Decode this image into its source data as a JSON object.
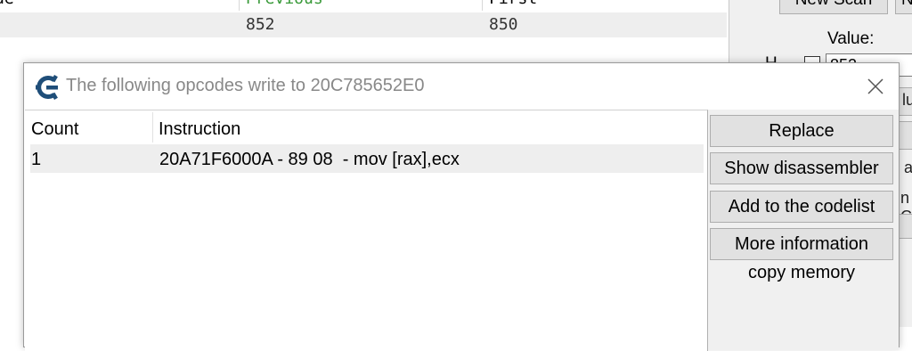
{
  "background": {
    "columns": {
      "value": "ue",
      "previous": "Previous",
      "first": "First"
    },
    "row": {
      "previous": "852",
      "first": "850"
    },
    "previous_color": "#3a9a3a",
    "panel": {
      "new_scan": "New Scan",
      "next_scan": "N",
      "value_label": "Value:",
      "hex_label": "H",
      "value_input": "852",
      "frag_1": "lu",
      "frag_2": "a",
      "frag_3": "n C"
    }
  },
  "dialog": {
    "title": "The following opcodes write to 20C785652E0",
    "columns": {
      "count": "Count",
      "instruction": "Instruction"
    },
    "rows": [
      {
        "count": "1",
        "instruction": "20A71F6000A - 89 08  - mov [rax],ecx"
      }
    ],
    "buttons": {
      "replace": "Replace",
      "show_disassembler": "Show disassembler",
      "add_to_codelist": "Add to the codelist",
      "more_information": "More information"
    },
    "copy_memory": "copy memory",
    "icons": {
      "app": "cheat-engine-logo-icon",
      "close": "close-icon"
    },
    "colors": {
      "title_text": "#888888",
      "logo": "#1f4e79"
    }
  }
}
